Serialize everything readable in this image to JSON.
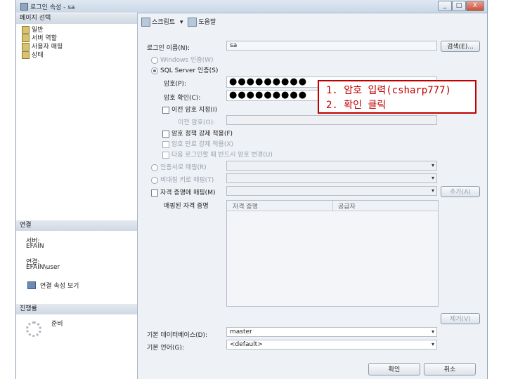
{
  "window": {
    "title": "로그인 속성 - sa",
    "controls": [
      "_",
      "□",
      "X"
    ]
  },
  "left_pane": {
    "select_page_header": "페이지 선택",
    "pages": [
      "일반",
      "서버 역할",
      "사용자 매핑",
      "상태"
    ],
    "connection_header": "연결",
    "server_label": "서버:",
    "server_value": "EFAIN",
    "connection_label": "연결:",
    "connection_value": "EFAIN\\user",
    "view_connection_link": "연결 속성 보기",
    "progress_header": "진행률",
    "progress_status": "준비"
  },
  "toolbar": {
    "script_label": "스크립트",
    "help_label": "도움말"
  },
  "form": {
    "login_name_label": "로그인 이름(N):",
    "login_name_value": "sa",
    "search_button": "검색(E)...",
    "windows_auth_label": "Windows 인증(W)",
    "sql_auth_label": "SQL Server 인증(S)",
    "password_label": "암호(P):",
    "password_value": "●●●●●●●●●",
    "confirm_password_label": "암호 확인(C):",
    "confirm_password_value": "●●●●●●●●●",
    "specify_old_password_label": "이전 암호 지정(I)",
    "old_password_label": "이전 암호(O):",
    "enforce_policy_label": "암호 정책 강제 적용(F)",
    "enforce_expiration_label": "암호 만료 강제 적용(X)",
    "must_change_label": "다음 로그인할 때 반드시 암호 변경(U)",
    "certificate_label": "인증서로 매핑(R)",
    "asymmetric_key_label": "비대칭 키로 매핑(T)",
    "credential_label": "자격 증명에 매핑(M)",
    "add_button": "추가(A)",
    "mapped_credentials_label": "매핑된 자격 증명",
    "grid_columns": [
      "자격 증명",
      "공급자"
    ],
    "remove_button": "제거(V)",
    "default_database_label": "기본 데이터베이스(D):",
    "default_database_value": "master",
    "default_language_label": "기본 언어(G):",
    "default_language_value": "<default>"
  },
  "callout": {
    "line1": "1. 암호 입력(csharp777)",
    "line2": "2. 확인 클릭"
  },
  "buttons": {
    "ok": "확인",
    "cancel": "취소"
  }
}
